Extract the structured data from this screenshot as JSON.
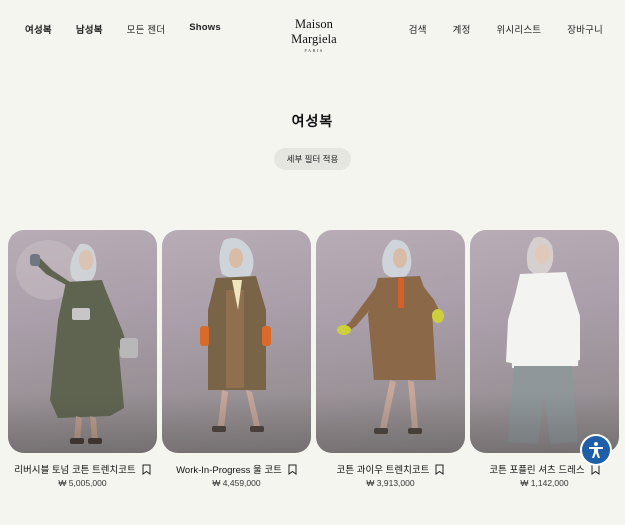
{
  "nav": {
    "left": [
      "여성복",
      "남성복",
      "모든 젠더",
      "Shows"
    ],
    "right": [
      "검색",
      "계정",
      "위시리스트",
      "장바구니"
    ]
  },
  "logo": {
    "main": "Maison Margiela",
    "sub": "PARIS"
  },
  "page": {
    "title": "여성복",
    "filter_button": "세부 필터 적용"
  },
  "products": [
    {
      "name": "리버시블 토넘 코튼 트렌치코트",
      "price": "₩ 5,005,000",
      "coat_color": "#5f6450"
    },
    {
      "name": "Work-In-Progress 울 코트",
      "price": "₩ 4,459,000",
      "coat_color": "#7a6448"
    },
    {
      "name": "코튼 과이우 트렌치코트",
      "price": "₩ 3,913,000",
      "coat_color": "#8a6848"
    },
    {
      "name": "코튼 포플린 셔츠 드레스",
      "price": "₩ 1,142,000",
      "coat_color": "#f3f3f1"
    }
  ],
  "colors": {
    "background": "#f5f5f0",
    "accessibility_button": "#1f5fa8"
  },
  "icons": [
    "bookmark-icon",
    "accessibility-icon"
  ]
}
